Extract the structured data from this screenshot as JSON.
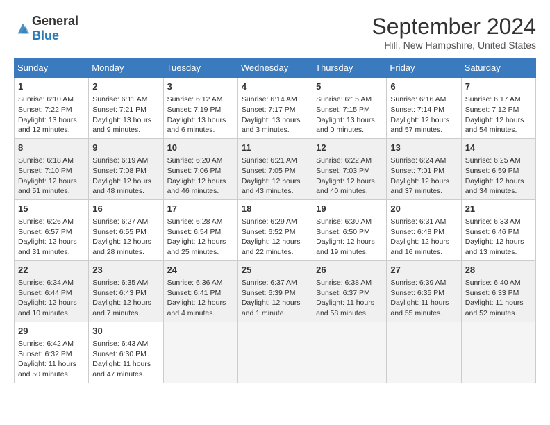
{
  "header": {
    "logo_general": "General",
    "logo_blue": "Blue",
    "month": "September 2024",
    "location": "Hill, New Hampshire, United States"
  },
  "days_of_week": [
    "Sunday",
    "Monday",
    "Tuesday",
    "Wednesday",
    "Thursday",
    "Friday",
    "Saturday"
  ],
  "weeks": [
    [
      {
        "day": "1",
        "info": "Sunrise: 6:10 AM\nSunset: 7:22 PM\nDaylight: 13 hours and 12 minutes."
      },
      {
        "day": "2",
        "info": "Sunrise: 6:11 AM\nSunset: 7:21 PM\nDaylight: 13 hours and 9 minutes."
      },
      {
        "day": "3",
        "info": "Sunrise: 6:12 AM\nSunset: 7:19 PM\nDaylight: 13 hours and 6 minutes."
      },
      {
        "day": "4",
        "info": "Sunrise: 6:14 AM\nSunset: 7:17 PM\nDaylight: 13 hours and 3 minutes."
      },
      {
        "day": "5",
        "info": "Sunrise: 6:15 AM\nSunset: 7:15 PM\nDaylight: 13 hours and 0 minutes."
      },
      {
        "day": "6",
        "info": "Sunrise: 6:16 AM\nSunset: 7:14 PM\nDaylight: 12 hours and 57 minutes."
      },
      {
        "day": "7",
        "info": "Sunrise: 6:17 AM\nSunset: 7:12 PM\nDaylight: 12 hours and 54 minutes."
      }
    ],
    [
      {
        "day": "8",
        "info": "Sunrise: 6:18 AM\nSunset: 7:10 PM\nDaylight: 12 hours and 51 minutes."
      },
      {
        "day": "9",
        "info": "Sunrise: 6:19 AM\nSunset: 7:08 PM\nDaylight: 12 hours and 48 minutes."
      },
      {
        "day": "10",
        "info": "Sunrise: 6:20 AM\nSunset: 7:06 PM\nDaylight: 12 hours and 46 minutes."
      },
      {
        "day": "11",
        "info": "Sunrise: 6:21 AM\nSunset: 7:05 PM\nDaylight: 12 hours and 43 minutes."
      },
      {
        "day": "12",
        "info": "Sunrise: 6:22 AM\nSunset: 7:03 PM\nDaylight: 12 hours and 40 minutes."
      },
      {
        "day": "13",
        "info": "Sunrise: 6:24 AM\nSunset: 7:01 PM\nDaylight: 12 hours and 37 minutes."
      },
      {
        "day": "14",
        "info": "Sunrise: 6:25 AM\nSunset: 6:59 PM\nDaylight: 12 hours and 34 minutes."
      }
    ],
    [
      {
        "day": "15",
        "info": "Sunrise: 6:26 AM\nSunset: 6:57 PM\nDaylight: 12 hours and 31 minutes."
      },
      {
        "day": "16",
        "info": "Sunrise: 6:27 AM\nSunset: 6:55 PM\nDaylight: 12 hours and 28 minutes."
      },
      {
        "day": "17",
        "info": "Sunrise: 6:28 AM\nSunset: 6:54 PM\nDaylight: 12 hours and 25 minutes."
      },
      {
        "day": "18",
        "info": "Sunrise: 6:29 AM\nSunset: 6:52 PM\nDaylight: 12 hours and 22 minutes."
      },
      {
        "day": "19",
        "info": "Sunrise: 6:30 AM\nSunset: 6:50 PM\nDaylight: 12 hours and 19 minutes."
      },
      {
        "day": "20",
        "info": "Sunrise: 6:31 AM\nSunset: 6:48 PM\nDaylight: 12 hours and 16 minutes."
      },
      {
        "day": "21",
        "info": "Sunrise: 6:33 AM\nSunset: 6:46 PM\nDaylight: 12 hours and 13 minutes."
      }
    ],
    [
      {
        "day": "22",
        "info": "Sunrise: 6:34 AM\nSunset: 6:44 PM\nDaylight: 12 hours and 10 minutes."
      },
      {
        "day": "23",
        "info": "Sunrise: 6:35 AM\nSunset: 6:43 PM\nDaylight: 12 hours and 7 minutes."
      },
      {
        "day": "24",
        "info": "Sunrise: 6:36 AM\nSunset: 6:41 PM\nDaylight: 12 hours and 4 minutes."
      },
      {
        "day": "25",
        "info": "Sunrise: 6:37 AM\nSunset: 6:39 PM\nDaylight: 12 hours and 1 minute."
      },
      {
        "day": "26",
        "info": "Sunrise: 6:38 AM\nSunset: 6:37 PM\nDaylight: 11 hours and 58 minutes."
      },
      {
        "day": "27",
        "info": "Sunrise: 6:39 AM\nSunset: 6:35 PM\nDaylight: 11 hours and 55 minutes."
      },
      {
        "day": "28",
        "info": "Sunrise: 6:40 AM\nSunset: 6:33 PM\nDaylight: 11 hours and 52 minutes."
      }
    ],
    [
      {
        "day": "29",
        "info": "Sunrise: 6:42 AM\nSunset: 6:32 PM\nDaylight: 11 hours and 50 minutes."
      },
      {
        "day": "30",
        "info": "Sunrise: 6:43 AM\nSunset: 6:30 PM\nDaylight: 11 hours and 47 minutes."
      },
      {
        "day": "",
        "info": ""
      },
      {
        "day": "",
        "info": ""
      },
      {
        "day": "",
        "info": ""
      },
      {
        "day": "",
        "info": ""
      },
      {
        "day": "",
        "info": ""
      }
    ]
  ]
}
